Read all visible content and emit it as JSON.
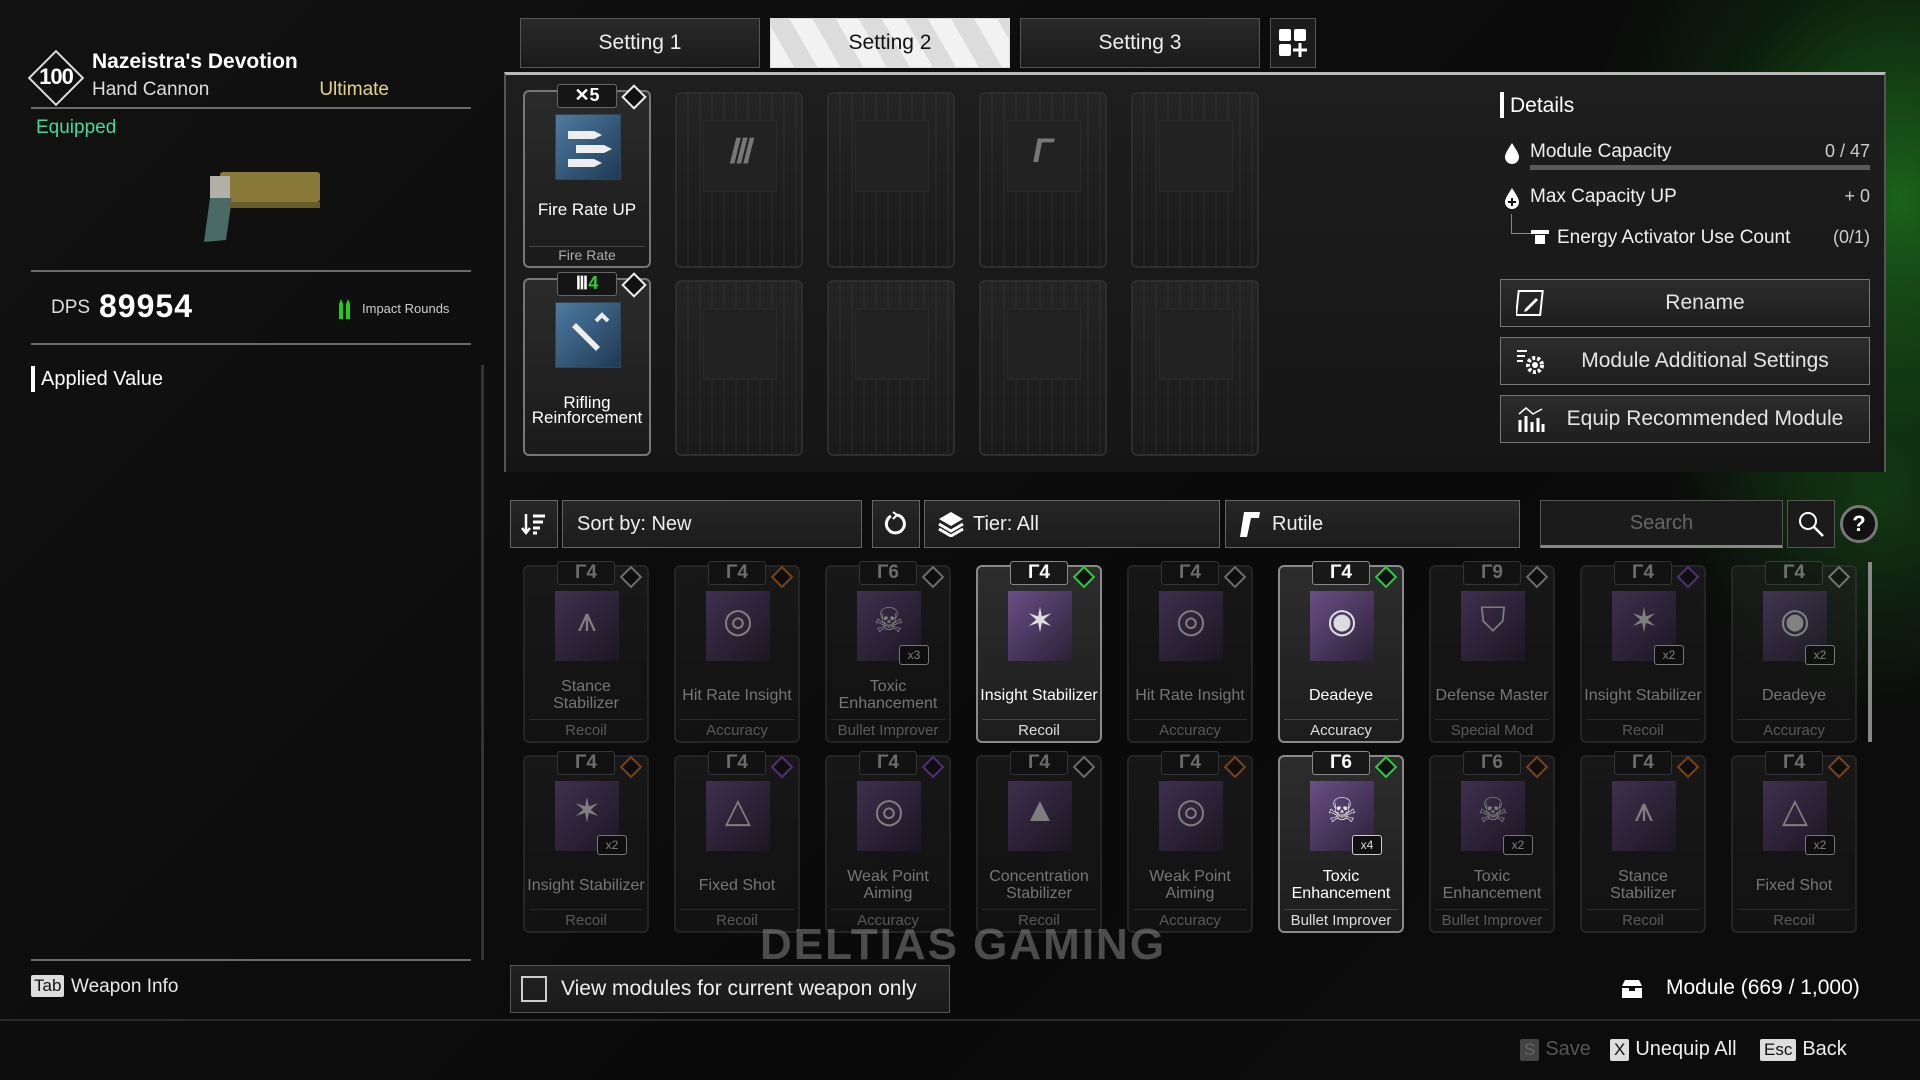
{
  "weapon": {
    "tier_level": "100",
    "name": "Nazeistra's Devotion",
    "type": "Hand Cannon",
    "rarity": "Ultimate",
    "status": "Equipped",
    "dps_label": "DPS",
    "dps_value": "89954",
    "ammo_type": "Impact Rounds",
    "applied_value_title": "Applied Value"
  },
  "settings_tabs": [
    {
      "label": "Setting 1",
      "active": false
    },
    {
      "label": "Setting 2",
      "active": true
    },
    {
      "label": "Setting 3",
      "active": false
    }
  ],
  "equipped_modules": [
    {
      "name": "Fire Rate UP",
      "category": "Fire Rate",
      "cost": "5",
      "cost_symbol": "✕",
      "socket": "standard"
    },
    {
      "name": "Rifling Reinforcement",
      "category": "",
      "cost": "4",
      "cost_symbol": "Ⅲ",
      "socket": "standard"
    }
  ],
  "empty_slots": [
    {
      "socket_symbol": "Ⅲ"
    },
    {
      "socket_symbol": ""
    },
    {
      "socket_symbol": "Γ"
    },
    {
      "socket_symbol": ""
    },
    {
      "socket_symbol": ""
    },
    {
      "socket_symbol": ""
    },
    {
      "socket_symbol": ""
    },
    {
      "socket_symbol": ""
    }
  ],
  "details": {
    "title": "Details",
    "module_capacity_label": "Module Capacity",
    "module_capacity_value": "0 / 47",
    "module_capacity_fraction": 0,
    "max_capacity_label": "Max Capacity UP",
    "max_capacity_value": "+ 0",
    "energy_activator_label": "Energy Activator Use Count",
    "energy_activator_value": "(0/1)"
  },
  "actions": {
    "rename": "Rename",
    "additional_settings": "Module Additional Settings",
    "equip_recommended": "Equip Recommended Module"
  },
  "filters": {
    "sort": "Sort by: New",
    "tier": "Tier: All",
    "socket": "Rutile",
    "search_placeholder": "Search",
    "help": "?"
  },
  "inventory": [
    {
      "name": "Stance Stabilizer",
      "category": "Recoil",
      "cost": "4",
      "mult": "",
      "highlight": false,
      "socket_color": "#bbbbbb",
      "glyph": "⩚"
    },
    {
      "name": "Hit Rate Insight",
      "category": "Accuracy",
      "cost": "4",
      "mult": "",
      "highlight": false,
      "socket_color": "#d0702a",
      "glyph": "◎"
    },
    {
      "name": "Toxic Enhancement",
      "category": "Bullet Improver",
      "cost": "6",
      "mult": "x3",
      "highlight": false,
      "socket_color": "#bbbbbb",
      "glyph": "☠"
    },
    {
      "name": "Insight Stabilizer",
      "category": "Recoil",
      "cost": "4",
      "mult": "",
      "highlight": true,
      "socket_color": "#2ecc40",
      "glyph": "✶"
    },
    {
      "name": "Hit Rate Insight",
      "category": "Accuracy",
      "cost": "4",
      "mult": "",
      "highlight": false,
      "socket_color": "#bbbbbb",
      "glyph": "◎"
    },
    {
      "name": "Deadeye",
      "category": "Accuracy",
      "cost": "4",
      "mult": "",
      "highlight": true,
      "socket_color": "#2ecc40",
      "glyph": "◉"
    },
    {
      "name": "Defense Master",
      "category": "Special Mod",
      "cost": "9",
      "mult": "",
      "highlight": false,
      "socket_color": "#bbbbbb",
      "glyph": "⛉"
    },
    {
      "name": "Insight Stabilizer",
      "category": "Recoil",
      "cost": "4",
      "mult": "x2",
      "highlight": false,
      "socket_color": "#8a4fd0",
      "glyph": "✶"
    },
    {
      "name": "Deadeye",
      "category": "Accuracy",
      "cost": "4",
      "mult": "x2",
      "highlight": false,
      "socket_color": "#bbbbbb",
      "glyph": "◉"
    },
    {
      "name": "Insight Stabilizer",
      "category": "Recoil",
      "cost": "4",
      "mult": "x2",
      "highlight": false,
      "socket_color": "#d0702a",
      "glyph": "✶"
    },
    {
      "name": "Fixed Shot",
      "category": "Recoil",
      "cost": "4",
      "mult": "",
      "highlight": false,
      "socket_color": "#8a4fd0",
      "glyph": "△"
    },
    {
      "name": "Weak Point Aiming",
      "category": "Accuracy",
      "cost": "4",
      "mult": "",
      "highlight": false,
      "socket_color": "#8a4fd0",
      "glyph": "◎"
    },
    {
      "name": "Concentration Stabilizer",
      "category": "Recoil",
      "cost": "4",
      "mult": "",
      "highlight": false,
      "socket_color": "#bbbbbb",
      "glyph": "▲"
    },
    {
      "name": "Weak Point Aiming",
      "category": "Accuracy",
      "cost": "4",
      "mult": "",
      "highlight": false,
      "socket_color": "#d0702a",
      "glyph": "◎"
    },
    {
      "name": "Toxic Enhancement",
      "category": "Bullet Improver",
      "cost": "6",
      "mult": "x4",
      "highlight": true,
      "socket_color": "#2ecc40",
      "glyph": "☠"
    },
    {
      "name": "Toxic Enhancement",
      "category": "Bullet Improver",
      "cost": "6",
      "mult": "x2",
      "highlight": false,
      "socket_color": "#d0702a",
      "glyph": "☠"
    },
    {
      "name": "Stance Stabilizer",
      "category": "Recoil",
      "cost": "4",
      "mult": "",
      "highlight": false,
      "socket_color": "#d0702a",
      "glyph": "⩚"
    },
    {
      "name": "Fixed Shot",
      "category": "Recoil",
      "cost": "4",
      "mult": "x2",
      "highlight": false,
      "socket_color": "#d0702a",
      "glyph": "△"
    }
  ],
  "footer": {
    "tab_key": "Tab",
    "weapon_info": "Weapon Info",
    "view_current_only": "View modules for current weapon only",
    "module_count": "Module (669 / 1,000)",
    "save_key": "S",
    "save": "Save",
    "unequip_key": "X",
    "unequip": "Unequip All",
    "back_key": "Esc",
    "back": "Back"
  },
  "watermark": "DELTIAS GAMING"
}
